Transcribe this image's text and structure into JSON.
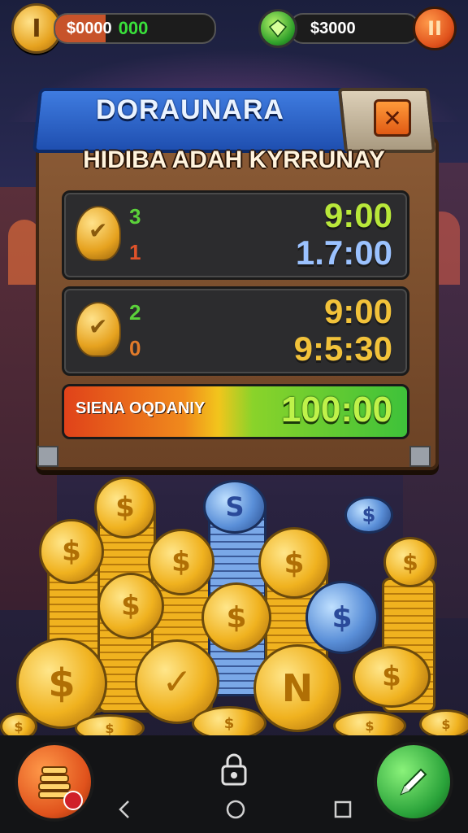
{
  "hud": {
    "left_coin_symbol": "I",
    "left_amount": "$0000",
    "left_count": "000",
    "right_amount": "$3000",
    "pause_symbol": "II"
  },
  "panel": {
    "title": "DORAUNARA",
    "close_symbol": "✕",
    "subtitle": "HIDIBA ADAH KYRRUNAY",
    "rows": [
      {
        "count_top": "3",
        "count_bottom": "1",
        "time_top": "9:00",
        "time_bottom": "1.7:00"
      },
      {
        "count_top": "2",
        "count_bottom": "0",
        "time_top": "9:00",
        "time_bottom": "9:5:30"
      }
    ],
    "progress_label": "SIENA OQDANIY",
    "progress_value": "100:00"
  },
  "colors": {
    "accent_blue": "#1f4fb0",
    "wood": "#6b4225",
    "gold": "#f0b21f",
    "green": "#3ec23a",
    "orange": "#e0521c"
  },
  "icons": {
    "shop": "coins-stack-icon",
    "go": "pencil-icon",
    "lock": "lock-icon",
    "nav_back": "back-icon",
    "nav_home": "home-icon",
    "nav_recent": "recent-apps-icon"
  }
}
